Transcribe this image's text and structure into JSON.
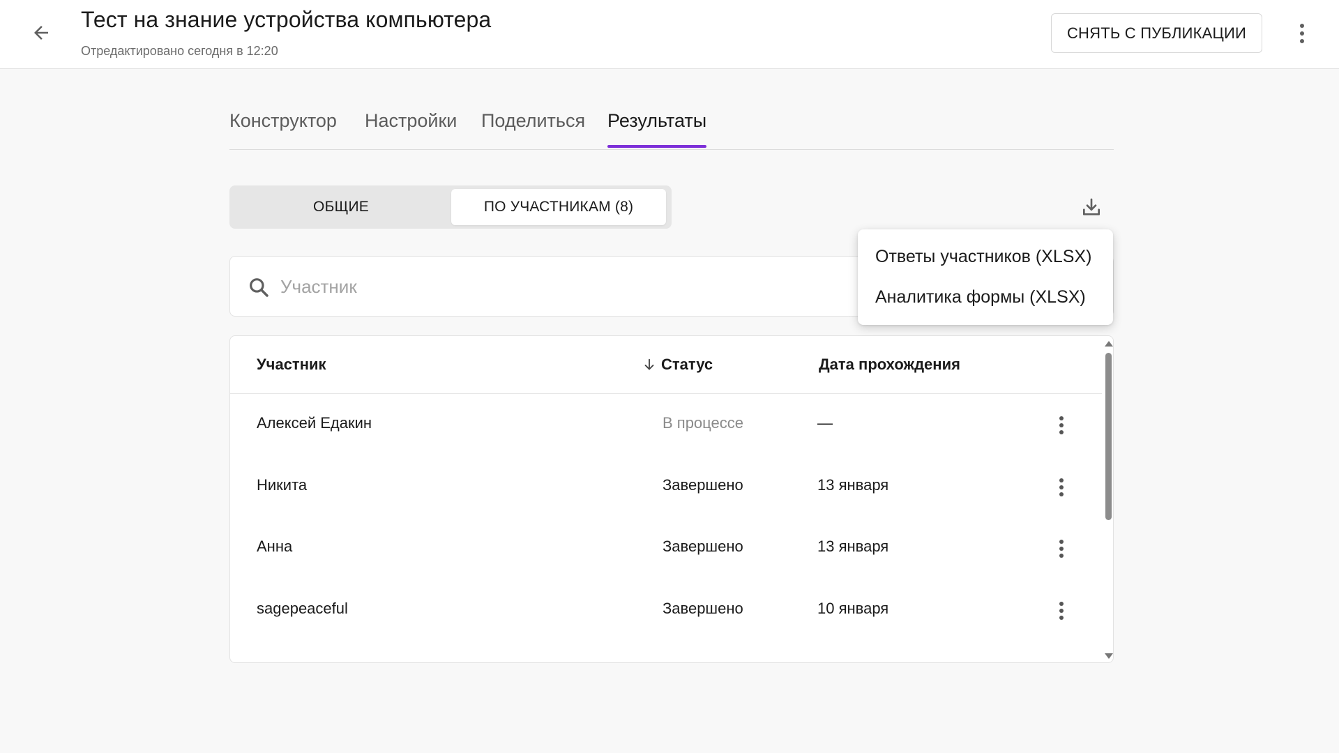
{
  "header": {
    "title": "Тест на знание устройства компьютера",
    "subtitle": "Отредактировано сегодня в 12:20",
    "unpublish_label": "СНЯТЬ С ПУБЛИКАЦИИ",
    "back_icon": "arrow-left-icon",
    "more_icon": "more-vertical-icon"
  },
  "tabs": [
    {
      "label": "Конструктор",
      "active": false
    },
    {
      "label": "Настройки",
      "active": false
    },
    {
      "label": "Поделиться",
      "active": false
    },
    {
      "label": "Результаты",
      "active": true
    }
  ],
  "segmented": {
    "general": "ОБЩИЕ",
    "by_participants": "ПО УЧАСТНИКАМ (8)",
    "selected": "by_participants"
  },
  "download_icon": "download-icon",
  "search": {
    "placeholder": "Участник",
    "value": "",
    "icon": "search-icon"
  },
  "export_menu": {
    "items": [
      {
        "label": "Ответы участников (XLSX)"
      },
      {
        "label": "Аналитика формы (XLSX)"
      }
    ]
  },
  "table": {
    "columns": {
      "participant": "Участник",
      "status": "Статус",
      "date": "Дата прохождения"
    },
    "sort_icon": "arrow-down-icon",
    "rows": [
      {
        "name": "Алексей Едакин",
        "status": "В процессе",
        "date": "—",
        "muted": true
      },
      {
        "name": "Никита",
        "status": "Завершено",
        "date": "13 января",
        "muted": false
      },
      {
        "name": "Анна",
        "status": "Завершено",
        "date": "13 января",
        "muted": false
      },
      {
        "name": "sagepeaceful",
        "status": "Завершено",
        "date": "10 января",
        "muted": false
      }
    ]
  },
  "colors": {
    "accent": "#7d2fd8",
    "background": "#f8f8f8",
    "surface": "#ffffff",
    "muted_text": "#8a8a8a"
  }
}
